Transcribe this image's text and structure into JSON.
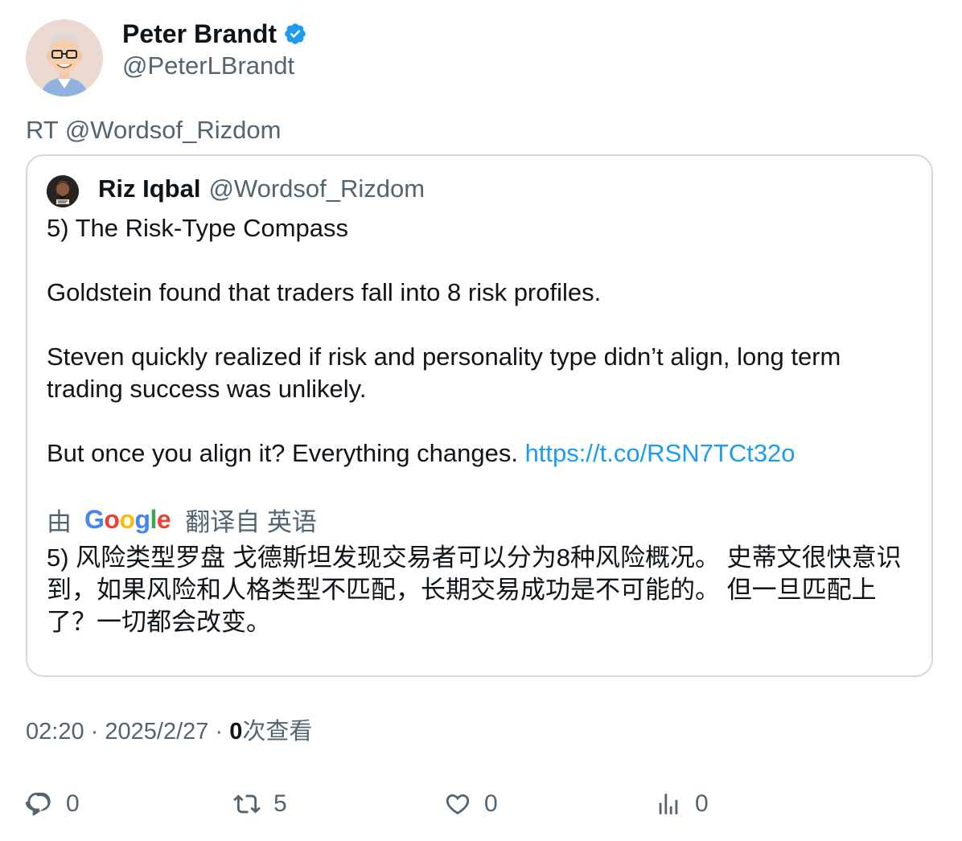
{
  "tweet": {
    "author_name": "Peter Brandt",
    "author_handle": "@PeterLBrandt",
    "rt_line": "RT @Wordsof_Rizdom",
    "verified_icon": "verified-badge-icon",
    "accent_color": "#1d9bf0"
  },
  "quote": {
    "name": "Riz Iqbal",
    "handle": "@Wordsof_Rizdom",
    "line1": "5) The Risk-Type Compass",
    "line2": "Goldstein found that traders fall into 8 risk profiles.",
    "line3": "Steven quickly realized if risk and personality type didn’t align, long term trading success was unlikely.",
    "line4": "But once you align it? Everything changes.",
    "link": "https://t.co/RSN7TCt32o"
  },
  "translation": {
    "prefix": "由",
    "google": "Google",
    "suffix": "翻译自 英语",
    "text": "5) 风险类型罗盘 戈德斯坦发现交易者可以分为8种风险概况。 史蒂文很快意识到，如果风险和人格类型不匹配，长期交易成功是不可能的。 但一旦匹配上了？一切都会改变。"
  },
  "meta": {
    "time": "02:20",
    "sep1": "·",
    "date": "2025/2/27",
    "sep2": "·",
    "views_count": "0",
    "views_label": "次查看"
  },
  "actions": {
    "reply_count": "0",
    "retweet_count": "5",
    "like_count": "0",
    "views_count": "0"
  }
}
